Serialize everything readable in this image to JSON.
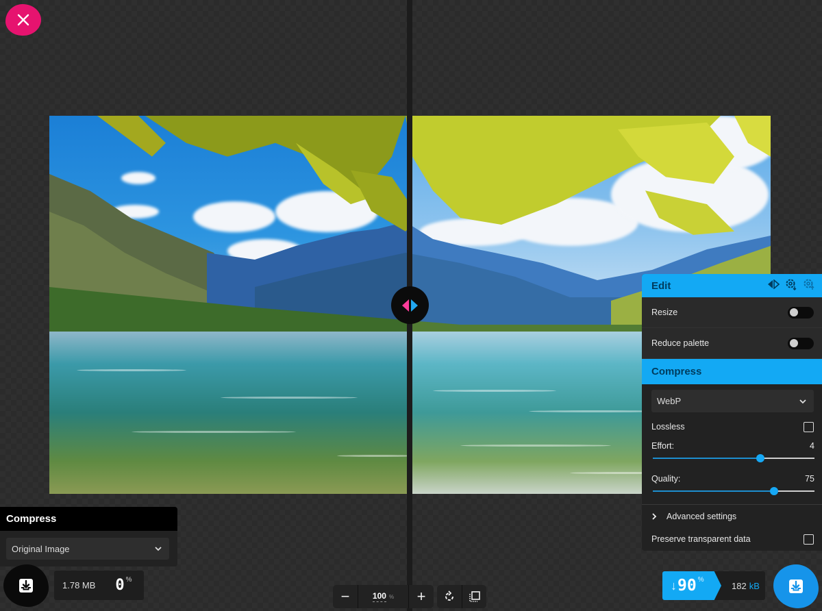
{
  "app": {
    "close_icon": "close-icon"
  },
  "comparison": {
    "divider_position_fraction": 0.5,
    "handle_icons": [
      "arrow-left-icon",
      "arrow-right-icon"
    ]
  },
  "left_panel": {
    "title": "Compress",
    "format_select": {
      "value": "Original Image"
    }
  },
  "left_result": {
    "size": "1.78 MB",
    "savings_value": "0",
    "savings_unit": "%"
  },
  "right_panel": {
    "edit": {
      "title": "Edit",
      "header_icons": [
        "compare-icon",
        "settings-save-icon",
        "settings-import-icon"
      ],
      "resize": {
        "label": "Resize",
        "enabled": false
      },
      "reduce_palette": {
        "label": "Reduce palette",
        "enabled": false
      }
    },
    "compress": {
      "title": "Compress",
      "format_select": {
        "value": "WebP"
      },
      "lossless": {
        "label": "Lossless",
        "checked": false
      },
      "effort": {
        "label": "Effort:",
        "value": "4",
        "min": 0,
        "max": 6,
        "fraction": 0.667
      },
      "quality": {
        "label": "Quality:",
        "value": "75",
        "min": 0,
        "max": 100,
        "fraction": 0.75
      },
      "advanced": {
        "label": "Advanced settings",
        "expanded": false
      },
      "preserve_transparent": {
        "label": "Preserve transparent data",
        "checked": false
      }
    }
  },
  "right_result": {
    "arrow": "↓",
    "savings_value": "90",
    "savings_unit": "%",
    "size_value": "182",
    "size_unit": "kB"
  },
  "zoom_controls": {
    "zoom_out": "−",
    "zoom_value": "100",
    "zoom_unit": "%",
    "zoom_in": "+"
  },
  "colors": {
    "accent_blue": "#13a9f4",
    "accent_pink": "#e6136f",
    "panel_bg": "#222222"
  }
}
